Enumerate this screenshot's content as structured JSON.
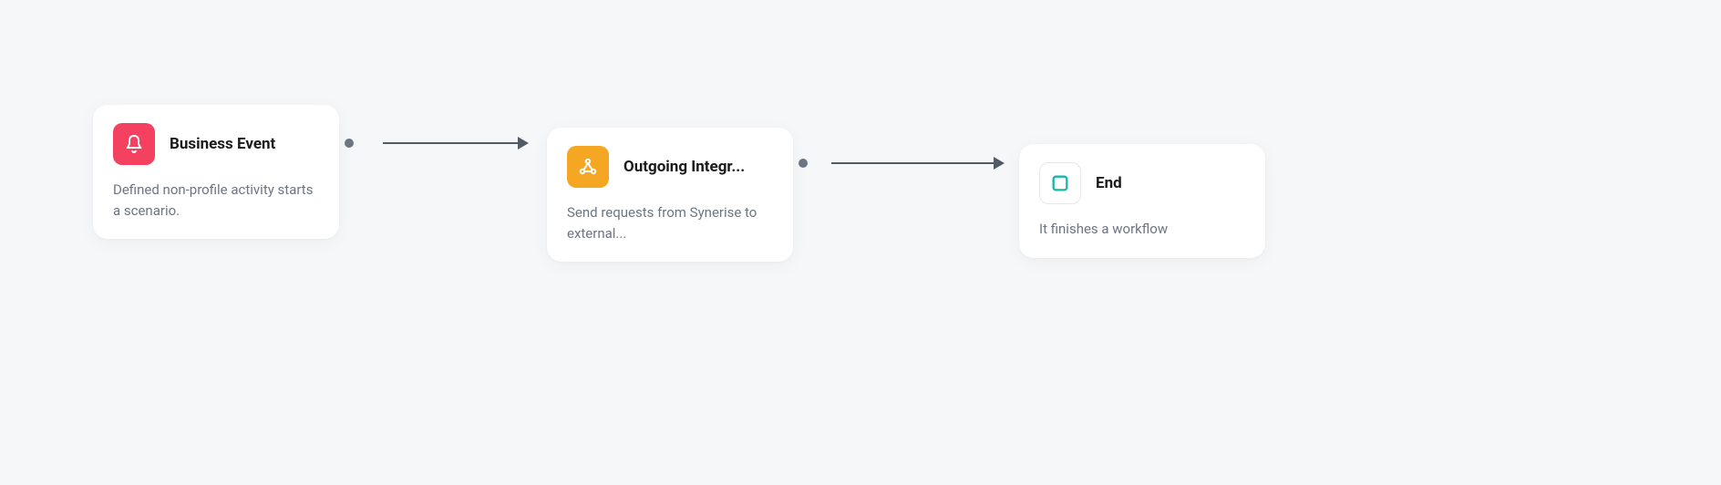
{
  "nodes": {
    "business_event": {
      "title": "Business Event",
      "description": "Defined non-profile activity starts a scenario.",
      "icon_name": "bell-icon",
      "icon_bg": "#f44160"
    },
    "outgoing_integration": {
      "title": "Outgoing Integr...",
      "description": "Send requests from Synerise to external...",
      "icon_name": "webhook-icon",
      "icon_bg": "#f5a623"
    },
    "end": {
      "title": "End",
      "description": "It finishes a workflow",
      "icon_name": "stop-icon",
      "icon_bg": "#ffffff"
    }
  },
  "colors": {
    "background": "#f6f7f8",
    "card_bg": "#ffffff",
    "title": "#1a1a1a",
    "description": "#6c7683",
    "connector": "#6c7683",
    "arrow": "#525a65"
  }
}
